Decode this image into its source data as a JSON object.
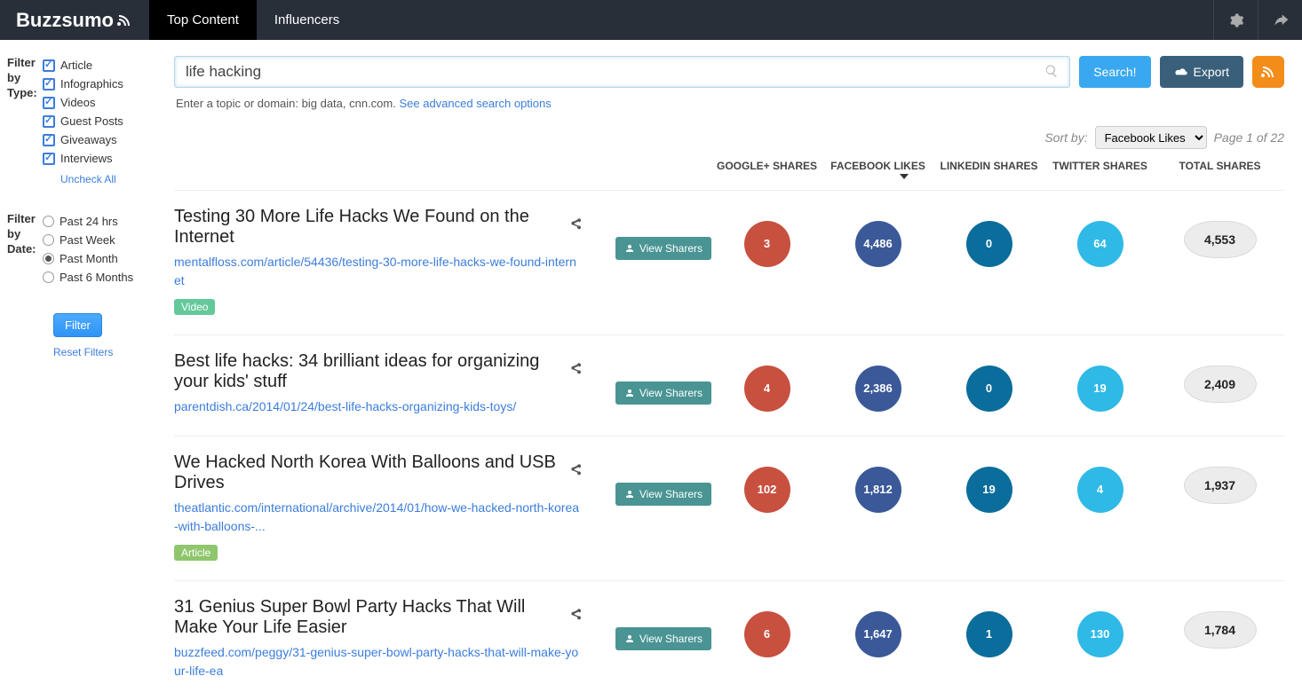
{
  "header": {
    "logo": "Buzzsumo",
    "tabs": [
      "Top Content",
      "Influencers"
    ]
  },
  "search": {
    "value": "life hacking",
    "hint_prefix": "Enter a topic or domain: big data, cnn.com. ",
    "advanced_link": "See advanced search options",
    "search_btn": "Search!",
    "export_btn": "Export"
  },
  "sidebar": {
    "type_label": "Filter by Type:",
    "types": [
      "Article",
      "Infographics",
      "Videos",
      "Guest Posts",
      "Giveaways",
      "Interviews"
    ],
    "uncheck": "Uncheck All",
    "date_label": "Filter by Date:",
    "dates": [
      "Past 24 hrs",
      "Past Week",
      "Past Month",
      "Past 6 Months"
    ],
    "date_selected": 2,
    "filter_btn": "Filter",
    "reset": "Reset Filters"
  },
  "sort": {
    "label": "Sort by:",
    "selected": "Facebook Likes",
    "page_text": "Page 1 of 22"
  },
  "columns": {
    "google": "GOOGLE+ SHARES",
    "fb": "FACEBOOK LIKES",
    "li": "LINKEDIN SHARES",
    "tw": "TWITTER SHARES",
    "total": "TOTAL SHARES"
  },
  "view_sharers": "View Sharers",
  "rows": [
    {
      "title": "Testing 30 More Life Hacks We Found on the Internet",
      "url": "mentalfloss.com/article/54436/testing-30-more-life-hacks-we-found-internet",
      "tag": "Video",
      "google": "3",
      "fb": "4,486",
      "li": "0",
      "tw": "64",
      "total": "4,553"
    },
    {
      "title": "Best life hacks: 34 brilliant ideas for organizing your kids' stuff",
      "url": "parentdish.ca/2014/01/24/best-life-hacks-organizing-kids-toys/",
      "tag": "",
      "google": "4",
      "fb": "2,386",
      "li": "0",
      "tw": "19",
      "total": "2,409"
    },
    {
      "title": "We Hacked North Korea With Balloons and USB Drives",
      "url": "theatlantic.com/international/archive/2014/01/how-we-hacked-north-korea-with-balloons-...",
      "tag": "Article",
      "google": "102",
      "fb": "1,812",
      "li": "19",
      "tw": "4",
      "total": "1,937"
    },
    {
      "title": "31 Genius Super Bowl Party Hacks That Will Make Your Life Easier",
      "url": "buzzfeed.com/peggy/31-genius-super-bowl-party-hacks-that-will-make-your-life-ea",
      "tag": "",
      "google": "6",
      "fb": "1,647",
      "li": "1",
      "tw": "130",
      "total": "1,784"
    }
  ]
}
